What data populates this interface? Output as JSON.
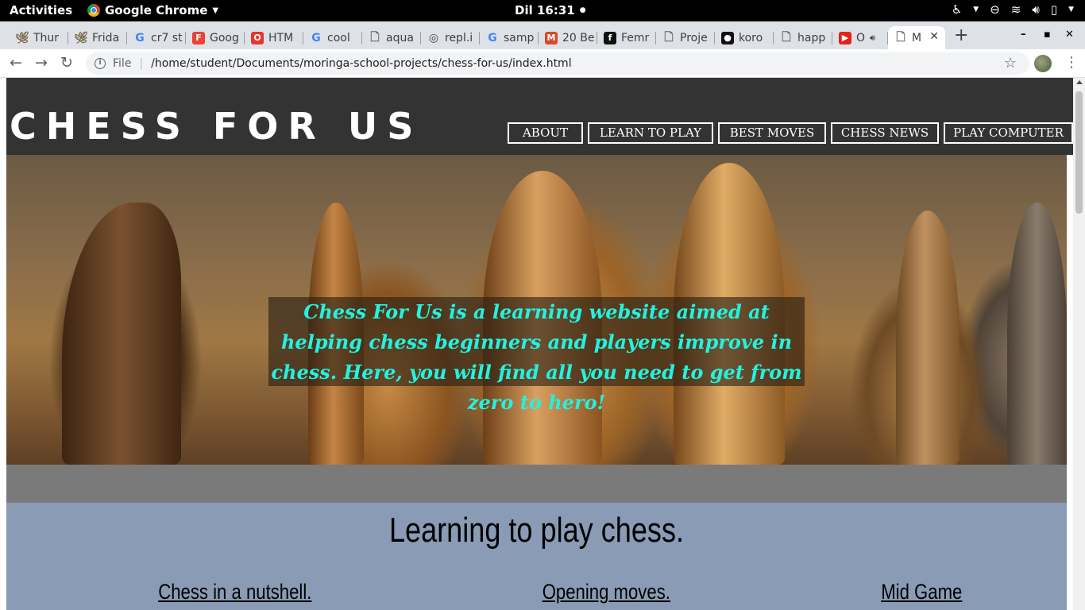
{
  "system_bar": {
    "activities": "Activities",
    "app_name": "Google Chrome",
    "clock": "Dil 16:31"
  },
  "browser": {
    "tabs": [
      {
        "title": "Thur",
        "icon": "tree-icon"
      },
      {
        "title": "Frida",
        "icon": "tree-icon"
      },
      {
        "title": "cr7 st",
        "icon": "google-icon"
      },
      {
        "title": "Goog",
        "icon": "f-logo-icon"
      },
      {
        "title": "HTM",
        "icon": "opera-icon"
      },
      {
        "title": "cool",
        "icon": "google-icon"
      },
      {
        "title": "aqua",
        "icon": "document-icon"
      },
      {
        "title": "repl.i",
        "icon": "replit-icon"
      },
      {
        "title": "samp",
        "icon": "google-icon"
      },
      {
        "title": "20 Be",
        "icon": "medium-icon"
      },
      {
        "title": "Femr",
        "icon": "femr-icon"
      },
      {
        "title": "Proje",
        "icon": "document-icon"
      },
      {
        "title": "koro",
        "icon": "github-icon"
      },
      {
        "title": "happ",
        "icon": "document-icon"
      },
      {
        "title": "O",
        "icon": "youtube-icon"
      },
      {
        "title": "M",
        "icon": "document-icon",
        "active": true
      }
    ],
    "address": {
      "scheme_label": "File",
      "url": "/home/student/Documents/moringa-school-projects/chess-for-us/index.html"
    }
  },
  "site": {
    "logo": "CHESS FOR US",
    "nav": [
      "ABOUT",
      "LEARN TO PLAY",
      "BEST MOVES",
      "CHESS NEWS",
      "PLAY COMPUTER"
    ],
    "hero_caption": "Chess For Us is a learning website aimed at helping chess beginners and players improve in chess. Here, you will find all you need to get from zero to hero!",
    "learn": {
      "title": "Learning to play chess.",
      "links": [
        "Chess in a nutshell.",
        "Opening moves.",
        "Mid Game"
      ]
    }
  },
  "colors": {
    "header_bg": "#333333",
    "caption_text": "#23f2e0",
    "learn_bg": "#8a9bb5",
    "band_bg": "#7a7a7a"
  }
}
